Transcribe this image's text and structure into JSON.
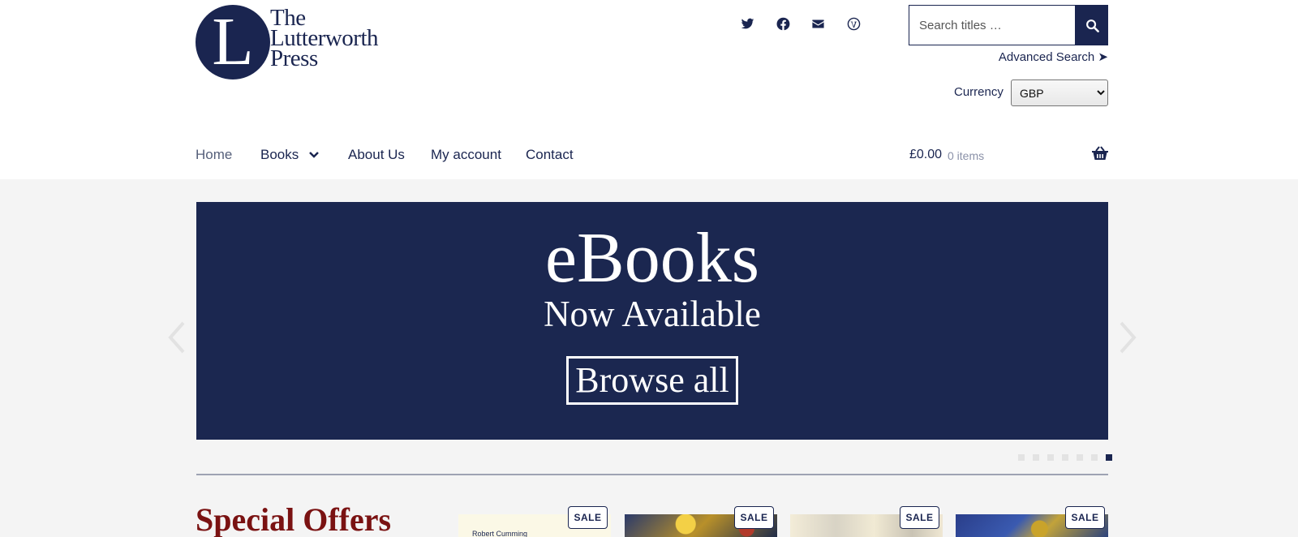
{
  "header": {
    "logo": {
      "line1": "The",
      "line2": "Lutterworth",
      "line3": "Press",
      "initial": "L"
    },
    "social_icons": [
      "twitter-icon",
      "facebook-icon",
      "envelope-icon",
      "wordpress-icon"
    ],
    "search": {
      "placeholder": "Search titles …",
      "value": ""
    },
    "advanced_search": "Advanced Search ➤",
    "currency": {
      "label": "Currency",
      "selected": "GBP"
    }
  },
  "nav": {
    "items": [
      {
        "label": "Home",
        "active": true
      },
      {
        "label": "Books",
        "has_dropdown": true
      },
      {
        "label": "About Us"
      },
      {
        "label": "My account"
      },
      {
        "label": "Contact"
      }
    ]
  },
  "cart": {
    "total": "£0.00",
    "count": "0 items"
  },
  "banner": {
    "title": "eBooks",
    "subtitle": "Now Available",
    "button": "Browse all",
    "slide_count": 7,
    "active_slide": 7
  },
  "special_offers": {
    "title": "Special Offers",
    "products": [
      {
        "badge": "SALE",
        "author": "Robert Cumming"
      },
      {
        "badge": "SALE"
      },
      {
        "badge": "SALE"
      },
      {
        "badge": "SALE"
      }
    ]
  },
  "colors": {
    "brand": "#1a2550",
    "accent": "#7a1212",
    "background": "#f4f4f4"
  }
}
